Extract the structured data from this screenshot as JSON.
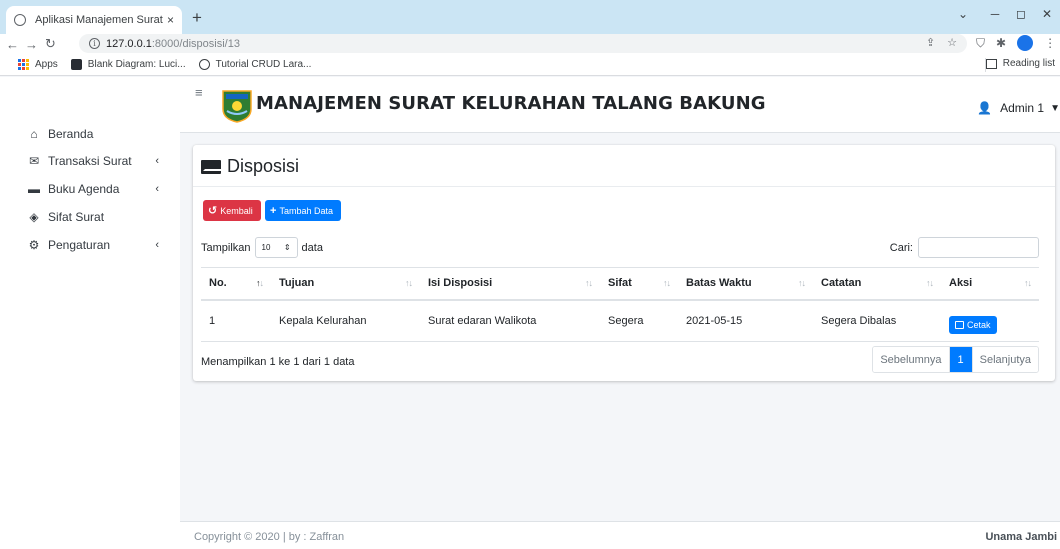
{
  "browser": {
    "tab_title": "Aplikasi Manajemen Surat",
    "tab_close": "×",
    "new_tab": "+",
    "url_host": "127.0.0.1",
    "url_path": ":8000/disposisi/13",
    "bookmarks": [
      "Apps",
      "Blank Diagram: Luci...",
      "Tutorial CRUD Lara..."
    ],
    "reading_list": "Reading list"
  },
  "app": {
    "title": "MANAJEMEN SURAT KELURAHAN TALANG BAKUNG",
    "user": "Admin 1"
  },
  "sidebar": {
    "items": [
      {
        "label": "Beranda",
        "icon": "home-icon"
      },
      {
        "label": "Transaksi Surat",
        "icon": "mail-bulk-icon"
      },
      {
        "label": "Buku Agenda",
        "icon": "book-icon"
      },
      {
        "label": "Sifat Surat",
        "icon": "layer-icon"
      },
      {
        "label": "Pengaturan",
        "icon": "cogs-icon"
      }
    ]
  },
  "page": {
    "title": "Disposisi",
    "btn_back": "Kembali",
    "btn_add": "Tambah Data",
    "show_prefix": "Tampilkan",
    "show_value": "10",
    "show_suffix": "data",
    "search_label": "Cari:",
    "columns": [
      "No.",
      "Tujuan",
      "Isi Disposisi",
      "Sifat",
      "Batas Waktu",
      "Catatan",
      "Aksi"
    ],
    "rows": [
      {
        "no": "1",
        "tujuan": "Kepala Kelurahan",
        "isi": "Surat edaran Walikota",
        "sifat": "Segera",
        "batas": "2021-05-15",
        "catatan": "Segera Dibalas",
        "aksi": "Cetak"
      }
    ],
    "info": "Menampilkan 1 ke 1 dari 1 data",
    "pager": {
      "prev": "Sebelumnya",
      "current": "1",
      "next": "Selanjutya"
    }
  },
  "footer": {
    "copy": "Copyright © 2020 | by : Zaffran",
    "right": "Unama Jambi"
  }
}
